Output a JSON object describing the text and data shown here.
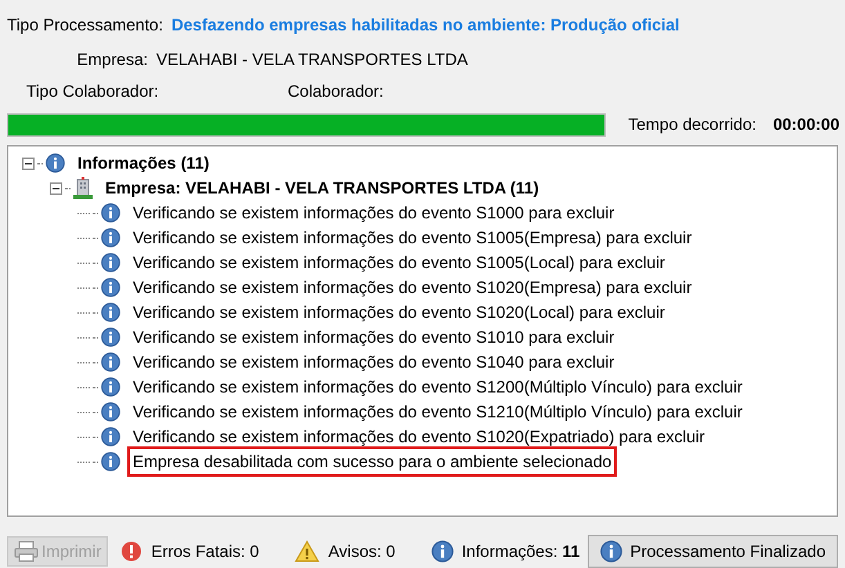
{
  "header": {
    "tipo_processamento": {
      "label": "Tipo Processamento:",
      "value": "Desfazendo empresas habilitadas no ambiente: Produção oficial"
    },
    "empresa": {
      "label": "Empresa:",
      "value": "VELAHABI - VELA TRANSPORTES LTDA"
    },
    "tipo_colaborador": {
      "label": "Tipo Colaborador:"
    },
    "colaborador": {
      "label": "Colaborador:"
    }
  },
  "progress": {
    "level": 1.0,
    "elapsed_label": "Tempo decorrido:",
    "elapsed_value": "00:00:00"
  },
  "tree": [
    {
      "kind": "info",
      "label": "Informações (11)",
      "expanded": true,
      "selected": false,
      "children": [
        {
          "kind": "company",
          "label": "Empresa: VELAHABI - VELA TRANSPORTES LTDA (11)",
          "expanded": true,
          "selected": false,
          "children": [
            {
              "kind": "info",
              "label": "Verificando se existem informações do evento S1000 para excluir",
              "selected": false
            },
            {
              "kind": "info",
              "label": "Verificando se existem informações do evento S1005(Empresa) para excluir",
              "selected": false
            },
            {
              "kind": "info",
              "label": "Verificando se existem informações do evento S1005(Local) para excluir",
              "selected": false
            },
            {
              "kind": "info",
              "label": "Verificando se existem informações do evento S1020(Empresa) para excluir",
              "selected": false
            },
            {
              "kind": "info",
              "label": "Verificando se existem informações do evento S1020(Local) para excluir",
              "selected": false
            },
            {
              "kind": "info",
              "label": "Verificando se existem informações do evento S1010 para excluir",
              "selected": false
            },
            {
              "kind": "info",
              "label": "Verificando se existem informações do evento S1040 para excluir",
              "selected": false
            },
            {
              "kind": "info",
              "label": "Verificando se existem informações do evento S1200(Múltiplo Vínculo) para excluir",
              "selected": false
            },
            {
              "kind": "info",
              "label": "Verificando se existem informações do evento S1210(Múltiplo Vínculo) para excluir",
              "selected": false
            },
            {
              "kind": "info",
              "label": "Verificando se existem informações do evento S1020(Expatriado) para excluir",
              "selected": false
            },
            {
              "kind": "info",
              "label": "Empresa desabilitada com sucesso para o ambiente selecionado",
              "selected": true
            }
          ]
        }
      ]
    }
  ],
  "footer": {
    "print_button": {
      "label": "Imprimir",
      "disabled": true
    },
    "counts": [
      {
        "kind": "error",
        "text": "Erros Fatais: 0"
      },
      {
        "kind": "warning",
        "text": "Avisos: 0"
      },
      {
        "kind": "info",
        "text": "Informações: **11**"
      }
    ],
    "finish_button": {
      "label": "Processamento Finalizado"
    }
  }
}
